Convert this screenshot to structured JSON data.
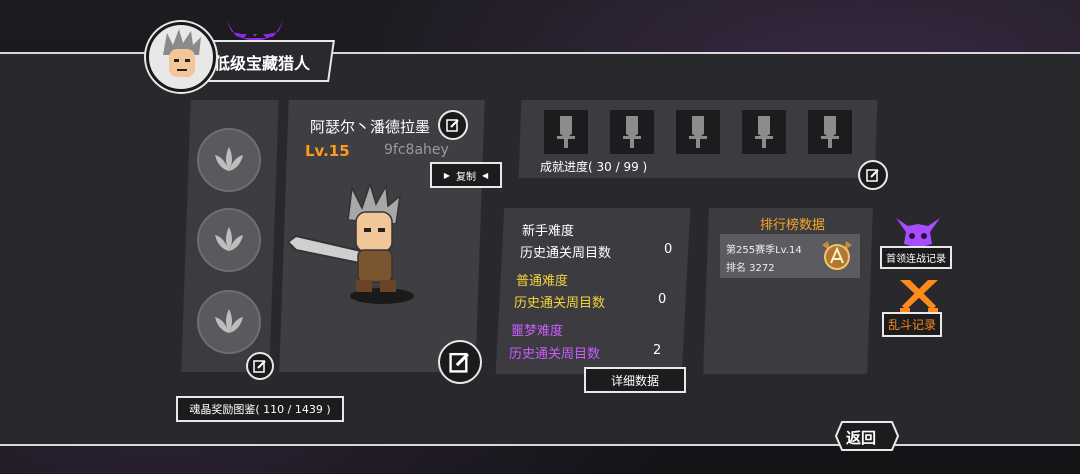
{
  "header": {
    "title": "低级宝藏猎人"
  },
  "character": {
    "name": "阿瑟尔丶潘德拉墨",
    "level": "Lv.15",
    "id": "9fc8ahey",
    "copy_label": "复制"
  },
  "achievement": {
    "progress_text": "成就进度( 30 / 99 )",
    "slots": 5
  },
  "difficulty": {
    "novice": {
      "title": "新手难度",
      "label": "历史通关周目数",
      "value": "0"
    },
    "normal": {
      "title": "普通难度",
      "label": "历史通关周目数",
      "value": "0"
    },
    "nightmare": {
      "title": "噩梦难度",
      "label": "历史通关周目数",
      "value": "2"
    },
    "detail_label": "详细数据"
  },
  "ranking": {
    "title": "排行榜数据",
    "season": "第255赛季Lv.14",
    "rank": "排名 3272"
  },
  "side_buttons": {
    "boss_rush": "首领连战记录",
    "brawl": "乱斗记录"
  },
  "soul_crystal": {
    "label": "魂晶奖励图鉴( 110 / 1439 )"
  },
  "return_label": "返回",
  "colors": {
    "accent_orange": "#ff9a1f",
    "normal_yellow": "#f2d23a",
    "nightmare_purple": "#c95cff",
    "rank_gold": "#f4a62a",
    "boss_purple": "#a64dff",
    "brawl_orange": "#ff8a1c"
  }
}
